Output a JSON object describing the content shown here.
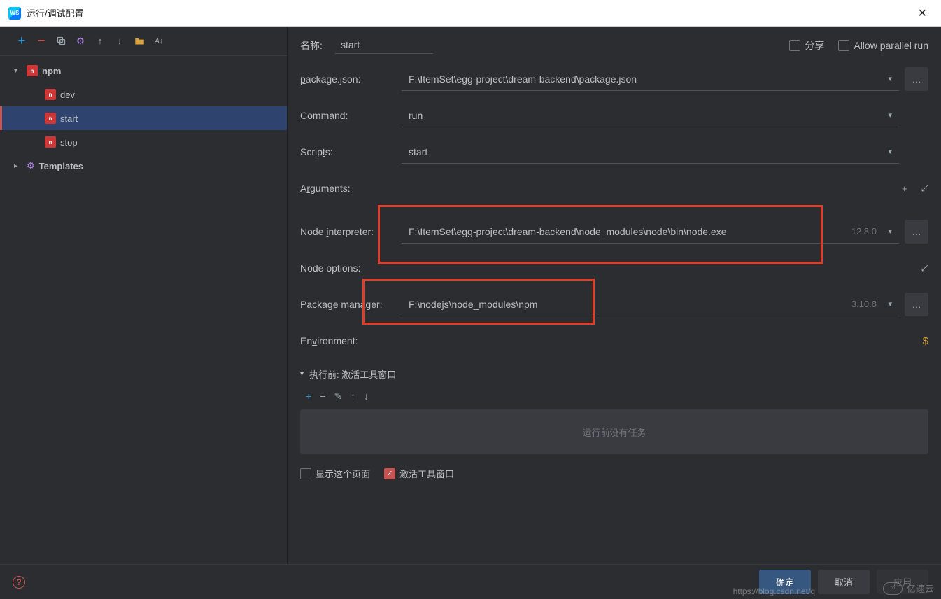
{
  "window": {
    "title": "运行/调试配置"
  },
  "toolbar_icons": [
    "add",
    "remove",
    "copy",
    "settings",
    "up",
    "down",
    "folder",
    "sort"
  ],
  "tree": {
    "npm_label": "npm",
    "items": [
      {
        "label": "dev"
      },
      {
        "label": "start"
      },
      {
        "label": "stop"
      }
    ],
    "templates_label": "Templates"
  },
  "form": {
    "name_label": "名称:",
    "name_value": "start",
    "share_label": "分享",
    "parallel_label": "Allow parallel run",
    "package_json_label": "package.json:",
    "package_json_value": "F:\\ItemSet\\egg-project\\dream-backend\\package.json",
    "command_label": "Command:",
    "command_value": "run",
    "scripts_label": "Scripts:",
    "scripts_value": "start",
    "arguments_label": "Arguments:",
    "node_interpreter_label": "Node interpreter:",
    "node_interpreter_value": "F:\\ItemSet\\egg-project\\dream-backend\\node_modules\\node\\bin\\node.exe",
    "node_interpreter_version": "12.8.0",
    "node_options_label": "Node options:",
    "package_manager_label": "Package manager:",
    "package_manager_value": "F:\\nodejs\\node_modules\\npm",
    "package_manager_version": "3.10.8",
    "environment_label": "Environment:"
  },
  "before_run": {
    "header": "执行前: 激活工具窗口",
    "empty_text": "运行前没有任务",
    "show_page_label": "显示这个页面",
    "activate_label": "激活工具窗口"
  },
  "footer": {
    "ok": "确定",
    "cancel": "取消",
    "apply": "应用"
  },
  "watermark": {
    "url": "https://blog.csdn.net/q",
    "brand": "亿速云"
  }
}
